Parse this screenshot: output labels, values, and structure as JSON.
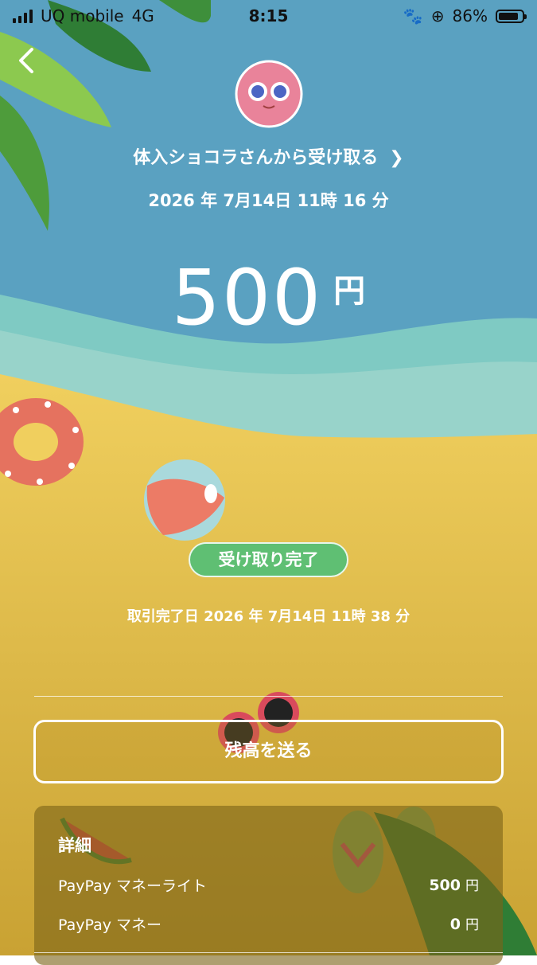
{
  "status_bar": {
    "carrier": "UQ mobile",
    "network": "4G",
    "time": "8:15",
    "battery": "86%",
    "battery_level": 0.86
  },
  "header": {
    "back_icon": "chevron-left-icon",
    "sender_text": "体入ショコラさんから受け取る",
    "datetime": "2026 年 7月14日 11時 16 分"
  },
  "amount": {
    "value": "500",
    "unit": "円"
  },
  "status": {
    "badge": "受け取り完了",
    "completed_at": "取引完了日 2026 年 7月14日 11時 38 分",
    "badge_color": "#5fbf73"
  },
  "actions": {
    "send_balance": "残高を送る"
  },
  "details": {
    "title": "詳細",
    "rows": [
      {
        "label": "PayPay マネーライト",
        "value": "500",
        "unit": "円"
      },
      {
        "label": "PayPay マネー",
        "value": "0",
        "unit": "円"
      }
    ]
  },
  "colors": {
    "sky": "#5aa0c0",
    "sea": "#86cbc4",
    "sand": "#e9c457"
  }
}
